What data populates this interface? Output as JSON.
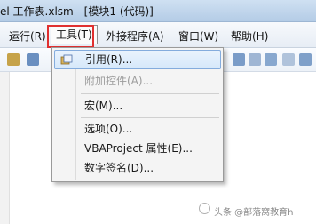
{
  "window": {
    "title": "el 工作表.xlsm - [模块1 (代码)]"
  },
  "menubar": {
    "items": [
      {
        "label": "运行(R)"
      },
      {
        "label": "工具(T)"
      },
      {
        "label": "外接程序(A)"
      },
      {
        "label": "窗口(W)"
      },
      {
        "label": "帮助(H)"
      }
    ]
  },
  "dropdown": {
    "items": [
      {
        "label": "引用(R)...",
        "state": "hover"
      },
      {
        "label": "附加控件(A)...",
        "state": "disabled"
      },
      {
        "label": "宏(M)..."
      },
      {
        "label": "选项(O)..."
      },
      {
        "label": "VBAProject 属性(E)..."
      },
      {
        "label": "数字签名(D)..."
      }
    ]
  },
  "watermark": {
    "text": "头条 @部落窝教育h"
  },
  "colors": {
    "highlight": "#e03030",
    "hover": "#d6e8fa",
    "menubar": "#e7edf5"
  }
}
